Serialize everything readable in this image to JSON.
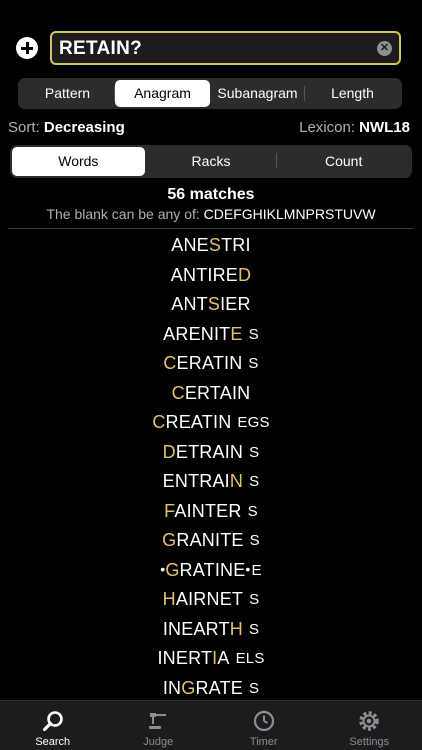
{
  "search": {
    "value": "RETAIN?"
  },
  "modes": [
    "Pattern",
    "Anagram",
    "Subanagram",
    "Length"
  ],
  "sort": {
    "label": "Sort:",
    "value": "Decreasing"
  },
  "lexicon": {
    "label": "Lexicon:",
    "value": "NWL18"
  },
  "views": [
    "Words",
    "Racks",
    "Count"
  ],
  "results": {
    "matches": "56 matches",
    "blank_label": "The blank can be any of:",
    "blank_letters": "CDEFGHIKLMNPRSTUVW"
  },
  "words": [
    {
      "pre": "ANE",
      "hl": "S",
      "post": "TRI",
      "hooks": ""
    },
    {
      "pre": "ANTIRE",
      "hl": "D",
      "post": "",
      "hooks": ""
    },
    {
      "pre": "ANT",
      "hl": "S",
      "post": "IER",
      "hooks": ""
    },
    {
      "pre": "ARENIT",
      "hl": "E",
      "post": "",
      "hooks": "S"
    },
    {
      "pre": "",
      "hl": "C",
      "post": "ERATIN",
      "hooks": "S"
    },
    {
      "pre": "",
      "hl": "C",
      "post": "ERTAIN",
      "hooks": ""
    },
    {
      "pre": "",
      "hl": "C",
      "post": "REATIN",
      "hooks": "EGS"
    },
    {
      "pre": "",
      "hl": "D",
      "post": "ETRAIN",
      "hooks": "S"
    },
    {
      "pre": "ENTRAI",
      "hl": "N",
      "post": "",
      "hooks": "S"
    },
    {
      "pre": "",
      "hl": "F",
      "post": "AINTER",
      "hooks": "S"
    },
    {
      "pre": "",
      "hl": "G",
      "post": "RANITE",
      "hooks": "S"
    },
    {
      "pre": "",
      "hl": "G",
      "post": "RATINE",
      "hooks": "E",
      "dots": true
    },
    {
      "pre": "",
      "hl": "H",
      "post": "AIRNET",
      "hooks": "S"
    },
    {
      "pre": "INEART",
      "hl": "H",
      "post": "",
      "hooks": "S"
    },
    {
      "pre": "INERT",
      "hl": "I",
      "post": "A",
      "hooks": "ELS"
    },
    {
      "pre": "IN",
      "hl": "G",
      "post": "RATE",
      "hooks": "S"
    }
  ],
  "tabs": [
    {
      "label": "Search",
      "icon": "search-icon"
    },
    {
      "label": "Judge",
      "icon": "gavel-icon"
    },
    {
      "label": "Timer",
      "icon": "clock-icon"
    },
    {
      "label": "Settings",
      "icon": "gear-icon"
    }
  ],
  "colors": {
    "highlight": "#e3c16f",
    "search_border": "#d4c25a"
  }
}
